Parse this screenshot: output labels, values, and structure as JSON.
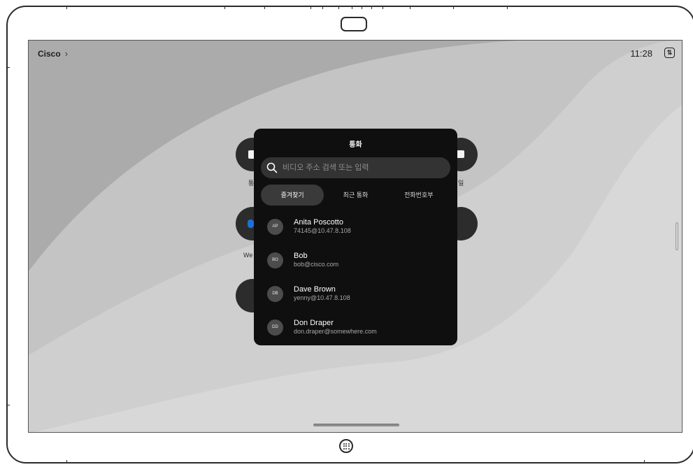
{
  "topbar": {
    "brand": "Cisco",
    "chevron": "›",
    "time": "11:28",
    "swap_icon": "⇅"
  },
  "background_apps": {
    "left_labels": [
      "통",
      "We"
    ],
    "right_labels": [
      "일"
    ]
  },
  "call_panel": {
    "title": "통화",
    "search_placeholder": "비디오 주소 검색 또는 입력",
    "tabs": [
      {
        "label": "즐겨찾기",
        "active": true
      },
      {
        "label": "최근 통화",
        "active": false
      },
      {
        "label": "전화번호부",
        "active": false
      }
    ],
    "contacts": [
      {
        "initials": "AP",
        "name": "Anita Poscotto",
        "address": "74145@10.47.8.108"
      },
      {
        "initials": "BO",
        "name": "Bob",
        "address": "bob@cisco.com"
      },
      {
        "initials": "DB",
        "name": "Dave Brown",
        "address": "yenny@10.47.8.108"
      },
      {
        "initials": "DD",
        "name": "Don Draper",
        "address": "don.draper@somewhere.com"
      }
    ]
  },
  "colors": {
    "panel_bg": "#0f0f0f",
    "screen_bg": "#ababab",
    "avatar_bg": "#4c4c4c",
    "accent_blue": "#1f6fd6"
  }
}
